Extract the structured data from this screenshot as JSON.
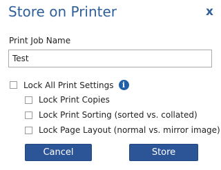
{
  "dialog": {
    "title": "Store on Printer",
    "close_label": "x"
  },
  "print_job": {
    "label": "Print Job Name",
    "value": "Test"
  },
  "options": {
    "lock_all": {
      "label": "Lock All Print Settings",
      "checked": false
    },
    "lock_copies": {
      "label": "Lock Print Copies",
      "checked": false
    },
    "lock_sorting": {
      "label": "Lock Print Sorting (sorted vs. collated)",
      "checked": false
    },
    "lock_layout": {
      "label": "Lock Page Layout (normal vs. mirror image)",
      "checked": false
    },
    "info_icon_glyph": "i"
  },
  "buttons": {
    "cancel_label": "Cancel",
    "store_label": "Store"
  },
  "colors": {
    "title": "#2e5f99",
    "button_bg": "#2c5597",
    "info_icon": "#1f5fa8"
  },
  "icons": {
    "info": "info-icon",
    "close": "close-icon"
  }
}
